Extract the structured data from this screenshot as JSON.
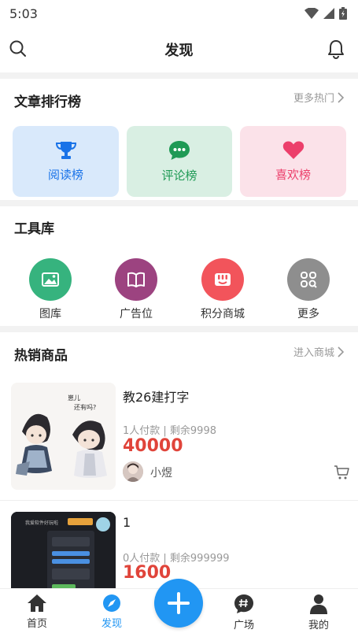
{
  "status": {
    "time": "5:03"
  },
  "header": {
    "title": "发现"
  },
  "ranking": {
    "title": "文章排行榜",
    "more": "更多热门",
    "cards": [
      {
        "label": "阅读榜",
        "icon": "trophy-icon",
        "color": "#1a73e8",
        "bg": "#d9e9fb"
      },
      {
        "label": "评论榜",
        "icon": "chat-icon",
        "color": "#1f9a55",
        "bg": "#d9efe3"
      },
      {
        "label": "喜欢榜",
        "icon": "heart-icon",
        "color": "#ec3f6b",
        "bg": "#fbe2e9"
      }
    ]
  },
  "tools": {
    "title": "工具库",
    "items": [
      {
        "label": "图库",
        "icon": "image-icon",
        "color": "#36b37e"
      },
      {
        "label": "广告位",
        "icon": "book-icon",
        "color": "#9c4380"
      },
      {
        "label": "积分商城",
        "icon": "store-icon",
        "color": "#f2545b"
      },
      {
        "label": "更多",
        "icon": "grid-search-icon",
        "color": "#8e8e8e"
      }
    ]
  },
  "products": {
    "title": "热销商品",
    "more": "进入商城",
    "items": [
      {
        "name": "教26建打字",
        "meta": "1人付款 | 剩余9998",
        "price": "40000",
        "seller": "小煜"
      },
      {
        "name": "1",
        "meta": "0人付款 | 剩余999999",
        "price": "1600"
      }
    ]
  },
  "tabbar": {
    "items": [
      {
        "label": "首页",
        "icon": "home-icon",
        "active": false
      },
      {
        "label": "发现",
        "icon": "compass-icon",
        "active": true
      },
      {
        "label": "广场",
        "icon": "hashtag-chat-icon",
        "active": false
      },
      {
        "label": "我的",
        "icon": "user-icon",
        "active": false
      }
    ],
    "active_color": "#2196f3"
  }
}
